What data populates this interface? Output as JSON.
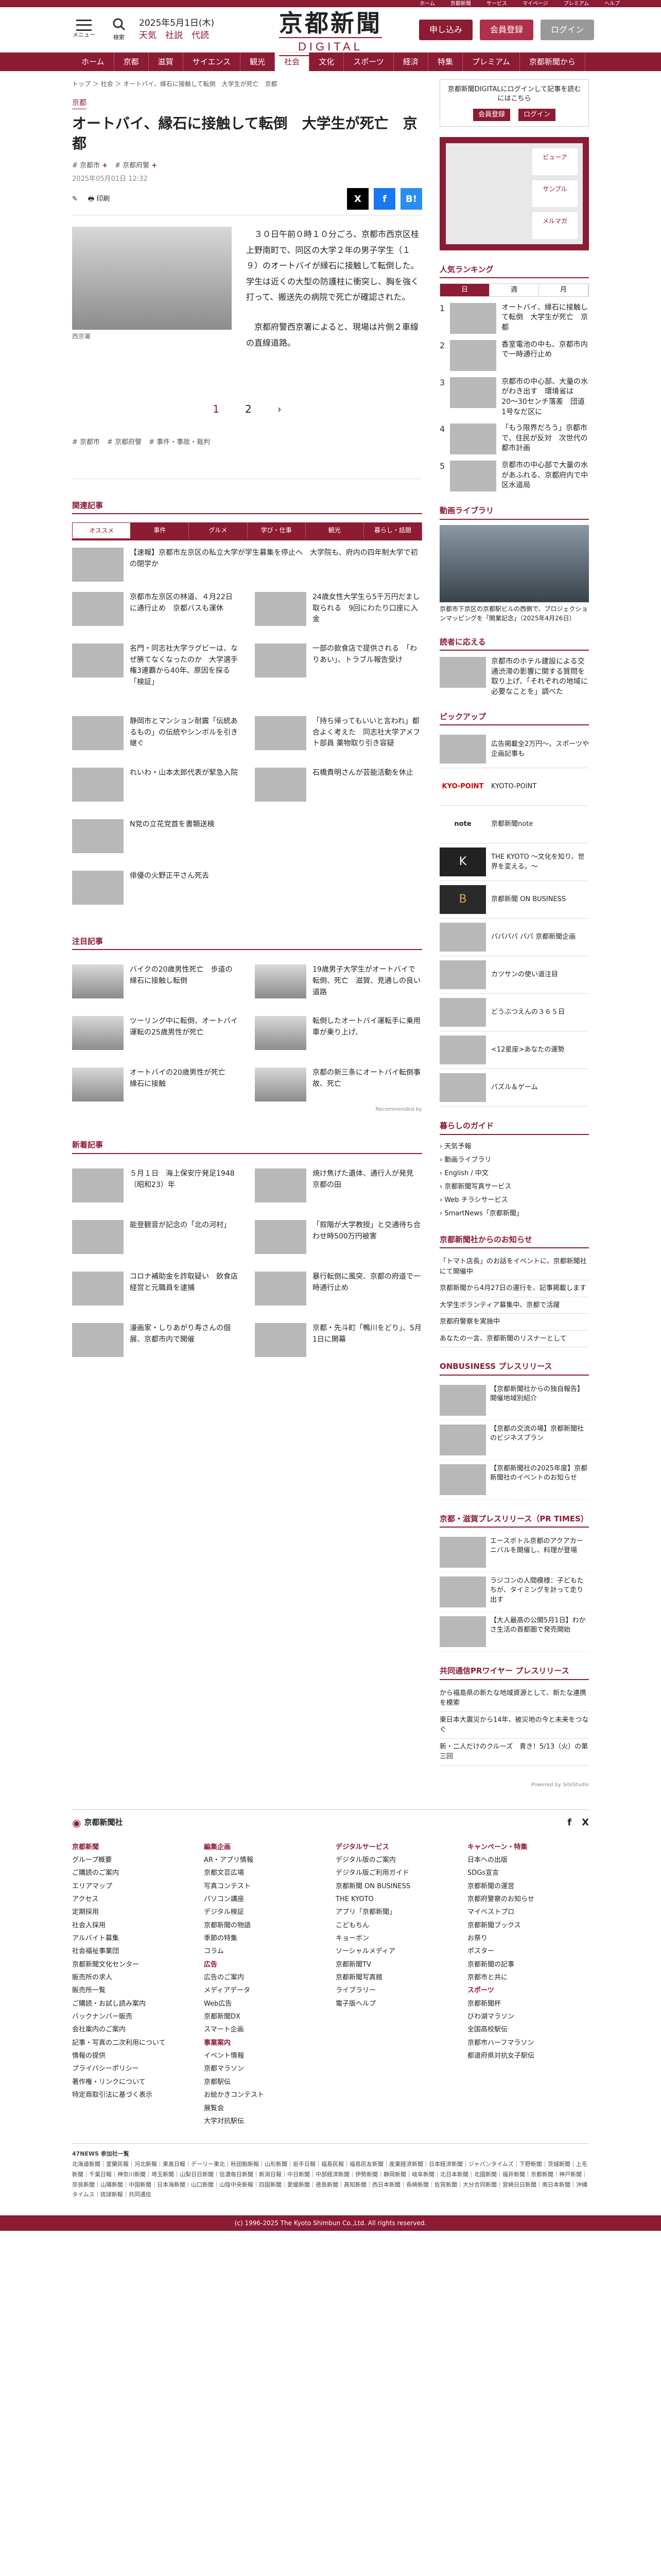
{
  "topbar": {
    "items": [
      "ホーム",
      "京都新聞",
      "サービス",
      "マイページ",
      "プレミアム",
      "ヘルプ"
    ]
  },
  "header": {
    "menu": "メニュー",
    "search": "検索",
    "date": "2025年5月1日(木)",
    "weather": "天気　社説　代読",
    "logo": "京都新聞",
    "logo_sub": "DIGITAL",
    "btn_apply": "申し込み",
    "btn_register": "会員登録",
    "btn_login": "ログイン"
  },
  "nav": [
    "ホーム",
    "京都",
    "滋賀",
    "サイエンス",
    "観光",
    "社会",
    "文化",
    "スポーツ",
    "経済",
    "特集",
    "プレミアム",
    "京都新聞から"
  ],
  "article": {
    "crumb": "トップ ＞ 社会 ＞ オートバイ、縁石に接触して転倒　大学生が死亡　京都",
    "category": "京都",
    "title": "オートバイ、縁石に接触して転倒　大学生が死亡　京都",
    "tags": [
      "京都市",
      "京都府警"
    ],
    "date": "2025年05月01日 12:32",
    "print": "印刷",
    "photo_caption": "西京署",
    "paragraphs": [
      "　３０日午前０時１０分ごろ、京都市西京区桂上野南町で、同区の大学２年の男子学生（１９）のオートバイが縁石に接触して転倒した。学生は近くの大型の防護柱に衝突し、胸を強く打って、搬送先の病院で死亡が確認された。",
      "　京都府警西京署によると、現場は片側２車線の直線道路。"
    ],
    "pages": [
      "1",
      "2"
    ],
    "next": "›",
    "tags2": [
      "京都市",
      "京都府警",
      "事件・事故・裁判"
    ]
  },
  "related": {
    "title": "関連記事",
    "tabs": [
      "オススメ",
      "事件",
      "グルメ",
      "学び・仕事",
      "観光",
      "暮らし・話題"
    ],
    "lead": "【速報】京都市左京区の私立大学が学生募集を停止へ　大学院も、府内の四年制大学で初の閉学か",
    "items": [
      "京都市左京区の林道、４月22日に通行止め　京都バスも運休",
      "24歳女性大学生ら5千万円だまし取られる　9回にわたり口座に入金",
      "名門・同志社大学ラグビーは、なぜ勝てなくなったのか　大学選手権3連覇から40年、原因を探る「検証」",
      "一部の飲食店で提供される　「わりあい」、トラブル報告受け"
    ],
    "col": [
      "静岡市とマンション耐震「伝統あるもの」の伝統やシンボルを引き継ぐ",
      "「持ち帰ってもいいと言われ」都合よく考えた　同志社大学アメフト部員 薬物取り引き容疑",
      "れいわ・山本太郎代表が緊急入院",
      "石橋貴明さんが芸能活動を休止",
      "N党の立花党首を書類送検",
      "俳優の火野正平さん死去"
    ]
  },
  "notice": {
    "title": "注目記事",
    "items": [
      "バイクの20歳男性死亡　歩道の縁石に接触し転倒",
      "19歳男子大学生がオートバイで転倒、死亡　滋賀、見通しの良い道路",
      "ツーリング中に転倒、オートバイ運転の25歳男性が死亡",
      "転倒したオートバイ運転手に乗用車が乗り上げ、",
      "オートバイの20歳男性が死亡　縁石に接触",
      "京都の新三条にオートバイ転倒事故、死亡"
    ],
    "recommend": "Recommended by"
  },
  "news": {
    "title": "新着記事",
    "items": [
      "５月１日　海上保安庁発足1948（昭和23）年",
      "焼け焦げた遺体、通行人が発見　京都の田",
      "能登観音が記念の「北の河村」",
      "「叙階が大学教授」と交通待ち合わせ時500万円被害",
      "コロナ補助金を詐取疑い　飲食店経営と元職員を逮捕",
      "暴行転倒に風突、京都の府道で一時通行止め",
      "漫画家・しりあがり寿さんの個展、京都市内で開催",
      "京都・先斗町「鴨川をどり」、5月1日に開幕"
    ]
  },
  "side": {
    "box_text": "京都新聞DIGITALにログインして記事を読むにはこちら",
    "box_btns": [
      "会員登録",
      "ログイン"
    ],
    "reg_items": [
      "ビューア",
      "サンプル",
      "メルマガ"
    ],
    "ranking_title": "人気ランキング",
    "ranking_tabs": [
      "日",
      "週",
      "月"
    ],
    "ranking": [
      "オートバイ、縁石に接触して転倒　大学生が死亡　京都",
      "香室電池の中も、京都市内で一時通行止め",
      "京都市の中心部、大量の水がわき出す　環境省は20〜30センチ落差　団道1号なだ区に",
      "「もう限界だろう」京都市で、住民が反対　次世代の都市計画",
      "京都市の中心部で大量の水があふれる、京都府内で中区水道局"
    ],
    "library_title": "動画ライブラリ",
    "library_caption": "京都市下京区の京都駅ビルの西側で、プロジェクションマッピングを「開業記念」（2025年4月26日）",
    "opinion_title": "読者に応える",
    "opinion_text": "京都市のホテル建設による交通渋滞の影響に関する質問を取り上げ、「それぞれの地域に必要なことを」調べた",
    "pickup_title": "ピックアップ",
    "pickup": [
      "広告掲載全2万円〜。スポーツや企画記事も",
      "KYOTO-POINT",
      "京都新聞note",
      "THE KYOTO ～文化を知り、世界を変える。～",
      "京都新聞 ON BUSINESS",
      "パパパパ パパ 京都新聞企画",
      "カツサンの使い道注目",
      "どうぶつえんの３６５日",
      "<12星座>あなたの運勢",
      "パズル＆ゲーム"
    ],
    "guide_title": "暮らしのガイド",
    "guide": [
      "天気予報",
      "動画ライブラリ",
      "English / 中文",
      "京都新聞写真サービス",
      "Web チラシサービス",
      "SmartNews「京都新聞」"
    ],
    "info_title": "京都新聞社からのお知らせ",
    "info": [
      "「トマト店長」のお話をイベントに、京都新聞社にて開催中",
      "京都新聞から4月27日の運行を、記事掲載します",
      "大学生ボランティア募集中、京都で活躍",
      "京都府警察を実施中",
      "あなたの一言、京都新聞のリスナーとして"
    ],
    "business_title": "ONBUSINESS プレスリリース",
    "business": [
      "【京都新聞社からの独自報告】開催地域別紹介",
      "【京都の交流の場】京都新聞社のビジネスプラン",
      "【京都新聞社の2025年度】京都新聞社のイベントのお知らせ"
    ],
    "press_title": "京都・滋賀プレスリリース（PR TIMES）",
    "press": [
      "エースボトル京都のアクアカーニバルを開催し、料理が登場",
      "ラジコンの人間模様：子どもたちが、タイミングを計って走り出す",
      "【大人最高の公開5月1日】わかさ生活の首都圏で発売開始"
    ],
    "wire_title": "共同通信PRワイヤー プレスリリース",
    "wire": [
      "から福島県の新たな地域資源として、新たな連携を模索",
      "東日本大震災から14年、被災地の今と未来をつなぐ",
      "新・二人だけのクルーズ　青き！5/13（火）の第三回"
    ]
  },
  "footer": {
    "brand": "京都新聞社",
    "powered": "Powered by SiteStudio",
    "cols": [
      {
        "h": "京都新聞",
        "items": [
          "グループ概要",
          "ご購読のご案内",
          "エリアマップ",
          "アクセス",
          "定期採用",
          "社会人採用",
          "アルバイト募集",
          "社会福祉事業団",
          "京都新聞文化センター",
          "販売所の求人",
          "販売所一覧",
          "ご購読・お試し読み案内",
          "バックナンバー販売",
          "会社案内のご案内",
          "記事・写真の二次利用について",
          "情報の提供",
          "プライバシーポリシー",
          "著作権・リンクについて",
          "特定商取引法に基づく表示"
        ]
      },
      {
        "h": "編集企画",
        "items": [
          "AR・アプリ情報",
          "京都文芸広場",
          "写真コンテスト",
          "パソコン講座",
          "デジタル検証",
          "京都新聞の物語",
          "季節の特集",
          "コラム"
        ],
        "h2": "広告",
        "items2": [
          "広告のご案内",
          "メディアデータ",
          "Web広告",
          "京都新聞DX",
          "スマート企画"
        ],
        "h3": "事業案内",
        "items3": [
          "イベント情報",
          "京都マラソン",
          "京都駅伝",
          "お絵かきコンテスト",
          "展覧会",
          "大学対抗駅伝"
        ]
      },
      {
        "h": "デジタルサービス",
        "items": [
          "デジタル版のご案内",
          "デジタル版ご利用ガイド",
          "京都新聞 ON BUSINESS",
          "THE KYOTO",
          "アプリ「京都新聞」",
          "こどもちん",
          "キョーボン",
          "ソーシャルメディア",
          "京都新聞TV",
          "京都新聞写真館",
          "ライブラリー",
          "電子版ヘルプ"
        ]
      },
      {
        "h": "キャンペーン・特集",
        "items": [
          "日本への出版",
          "SDGs宣言",
          "京都新聞の運営",
          "京都府警察のお知らせ",
          "マイベストプロ",
          "京都新聞ブックス",
          "お祭り",
          "ポスター",
          "京都新聞の記事",
          "京都市と共に"
        ],
        "h2": "スポーツ",
        "items2": [
          "京都新聞杯",
          "びわ湖マラソン",
          "全国高校駅伝",
          "京都市ハーフマラソン",
          "都道府県対抗女子駅伝"
        ]
      }
    ],
    "net_title": "47NEWS 参加社一覧",
    "net": "北海道新聞｜室蘭民報｜河北新報｜東奥日報｜デーリー東北｜秋田魁新報｜山形新聞｜岩手日報｜福島民報｜福島民友新聞｜産業経済新聞｜日本経済新聞｜ジャパンタイムズ｜下野新聞｜茨城新聞｜上毛新聞｜千葉日報｜神奈川新聞｜埼玉新聞｜山梨日日新聞｜信濃毎日新聞｜新潟日報｜中日新聞｜中部経済新聞｜伊勢新聞｜静岡新聞｜岐阜新聞｜北日本新聞｜北國新聞｜福井新聞｜京都新聞｜神戸新聞｜奈良新聞｜山陽新聞｜中国新聞｜日本海新聞｜山口新聞｜山陰中央新報｜四国新聞｜愛媛新聞｜徳島新聞｜高知新聞｜西日本新聞｜長崎新聞｜佐賀新聞｜大分合同新聞｜宮崎日日新聞｜南日本新聞｜沖縄タイムス｜琉球新報｜共同通信",
    "copyright": "(c) 1996-2025 The Kyoto Shimbun Co.,Ltd. All rights reserved."
  },
  "colors": {
    "brand": "#8c1b34"
  }
}
